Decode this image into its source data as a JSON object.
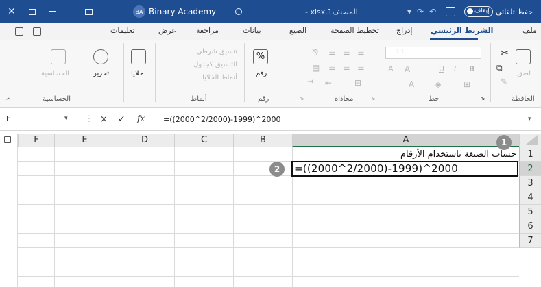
{
  "titlebar": {
    "avatar_initials": "BA",
    "account_name": "Binary Academy",
    "file_name": "المصنف1.xlsx -",
    "autosave_label": "حفظ تلقائي",
    "autosave_state": "إيقاف"
  },
  "tabs": [
    {
      "label": "ملف"
    },
    {
      "label": "الشريط الرئيسي"
    },
    {
      "label": "إدراج"
    },
    {
      "label": "تخطيط الصفحة"
    },
    {
      "label": "الصيغ"
    },
    {
      "label": "بيانات"
    },
    {
      "label": "مراجعة"
    },
    {
      "label": "عرض"
    },
    {
      "label": "تعليمات"
    }
  ],
  "ribbon": {
    "clipboard": {
      "label": "الحافظة",
      "paste": "لصق"
    },
    "font": {
      "label": "خط",
      "size": "11",
      "bold": "B",
      "italic": "I",
      "underline": "U",
      "grow": "A",
      "shrink": "A"
    },
    "alignment": {
      "label": "محاذاة"
    },
    "number": {
      "label": "رقم",
      "symbol": "%"
    },
    "styles": {
      "label": "أنماط",
      "conditional": "تنسيق شرطي",
      "as_table": "التنسيق كجدول",
      "cell_styles": "أنماط الخلايا"
    },
    "cells": {
      "label": "خلايا"
    },
    "editing": {
      "label": "تحرير"
    },
    "sensitivity": {
      "label": "الحساسية",
      "group_label": "الحساسية"
    }
  },
  "formula_bar": {
    "name_box": "IF",
    "cancel_icon": "×",
    "enter_icon": "✓",
    "fx_label": "fx",
    "formula": "=((2000^2/2000)-1999)^2000"
  },
  "columns": [
    "F",
    "E",
    "D",
    "C",
    "B",
    "A"
  ],
  "rows": [
    "1",
    "2",
    "3",
    "4",
    "5",
    "6",
    "7"
  ],
  "cells": {
    "A1": "حساب الصيغة باستخدام الأرقام",
    "A2": "=((2000^2/2000)-1999)^2000"
  },
  "callouts": [
    "1",
    "2"
  ],
  "colors": {
    "title_bar": "#1e4d91",
    "selection_green": "#217346",
    "callout_grey": "#8c8c8c"
  }
}
